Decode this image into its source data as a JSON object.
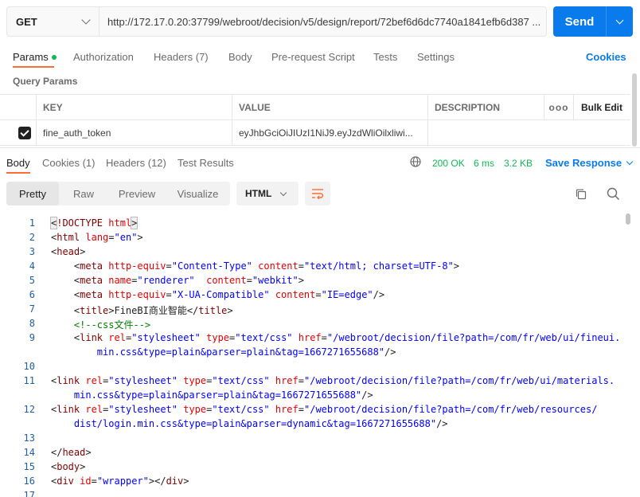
{
  "request": {
    "method": "GET",
    "url": "http://172.17.0.20:37799/webroot/decision/v5/design/report/72bef6d6dc7740a1841efb6d387 ...",
    "send_label": "Send"
  },
  "request_tabs": [
    {
      "label": "Params",
      "active": true
    },
    {
      "label": "Authorization"
    },
    {
      "label": "Headers (7)"
    },
    {
      "label": "Body"
    },
    {
      "label": "Pre-request Script"
    },
    {
      "label": "Tests"
    },
    {
      "label": "Settings"
    }
  ],
  "cookies_label": "Cookies",
  "query_params_title": "Query Params",
  "params_table": {
    "headers": [
      "KEY",
      "VALUE",
      "DESCRIPTION",
      "ooo",
      "Bulk Edit"
    ],
    "rows": [
      {
        "checked": true,
        "key": "fine_auth_token",
        "value": "eyJhbGciOiJIUzI1NiJ9.eyJzdWliOilxliwi...",
        "description": ""
      }
    ]
  },
  "response_tabs": [
    {
      "label": "Body",
      "active": true
    },
    {
      "label": "Cookies (1)"
    },
    {
      "label": "Headers (12)"
    },
    {
      "label": "Test Results"
    }
  ],
  "response_status": {
    "code": "200 OK",
    "time": "6 ms",
    "size": "3.2 KB"
  },
  "save_response_label": "Save Response",
  "view_modes": [
    {
      "label": "Pretty",
      "active": true
    },
    {
      "label": "Raw"
    },
    {
      "label": "Preview"
    },
    {
      "label": "Visualize"
    }
  ],
  "language": "HTML",
  "colors": {
    "accent": "#097bed",
    "tab_indicator": "#ff6c37",
    "success": "#0cbb52"
  },
  "code_lines": [
    {
      "n": "1",
      "html": "<span class=\"b hl\">&lt;</span><span class=\"t\">!DOCTYPE</span> <span class=\"a\">html</span><span class=\"b hl\">&gt;</span>"
    },
    {
      "n": "2",
      "html": "<span class=\"b\">&lt;</span><span class=\"t\">html</span> <span class=\"a\">lang</span>=<span class=\"s\">\"en\"</span>&gt;"
    },
    {
      "n": "3",
      "html": "&lt;<span class=\"t\">head</span>&gt;"
    },
    {
      "n": "4",
      "html": "    &lt;<span class=\"t\">meta</span> <span class=\"a\">http-equiv</span>=<span class=\"s\">\"Content-Type\"</span> <span class=\"a\">content</span>=<span class=\"s\">\"text/html; charset=UTF-8\"</span>&gt;"
    },
    {
      "n": "5",
      "html": "    &lt;<span class=\"t\">meta</span> <span class=\"a\">name</span>=<span class=\"s\">\"renderer\"</span>  <span class=\"a\">content</span>=<span class=\"s\">\"webkit\"</span>&gt;"
    },
    {
      "n": "6",
      "html": "    &lt;<span class=\"t\">meta</span> <span class=\"a\">http-equiv</span>=<span class=\"s\">\"X-UA-Compatible\"</span> <span class=\"a\">content</span>=<span class=\"s\">\"IE=edge\"</span>/&gt;"
    },
    {
      "n": "7",
      "html": "    &lt;<span class=\"t\">title</span>&gt;FineBI商业智能&lt;/<span class=\"t\">title</span>&gt;"
    },
    {
      "n": "8",
      "html": "    <span class=\"c\">&lt;!--css文件--&gt;</span>"
    },
    {
      "n": "9",
      "html": "    &lt;<span class=\"t\">link</span> <span class=\"a\">rel</span>=<span class=\"s\">\"stylesheet\"</span> <span class=\"a\">type</span>=<span class=\"s\">\"text/css\"</span> <span class=\"a\">href</span>=<span class=\"s\">\"/webroot/decision/file?path=/com/fr/web/ui/fineui.</span>"
    },
    {
      "n": "",
      "html": "        <span class=\"s\">min.css&amp;type=plain&amp;parser=plain&amp;tag=1667271655688\"</span>/&gt;"
    },
    {
      "n": "10",
      "html": ""
    },
    {
      "n": "11",
      "html": "&lt;<span class=\"t\">link</span> <span class=\"a\">rel</span>=<span class=\"s\">\"stylesheet\"</span> <span class=\"a\">type</span>=<span class=\"s\">\"text/css\"</span> <span class=\"a\">href</span>=<span class=\"s\">\"/webroot/decision/file?path=/com/fr/web/ui/materials.</span>"
    },
    {
      "n": "",
      "html": "    <span class=\"s\">min.css&amp;type=plain&amp;parser=plain&amp;tag=1667271655688\"</span>/&gt;"
    },
    {
      "n": "12",
      "html": "&lt;<span class=\"t\">link</span> <span class=\"a\">rel</span>=<span class=\"s\">\"stylesheet\"</span> <span class=\"a\">type</span>=<span class=\"s\">\"text/css\"</span> <span class=\"a\">href</span>=<span class=\"s\">\"/webroot/decision/file?path=/com/fr/web/resources/</span>"
    },
    {
      "n": "",
      "html": "    <span class=\"s\">dist/login.min.css&amp;type=plain&amp;parser=dynamic&amp;tag=1667271655688\"</span>/&gt;"
    },
    {
      "n": "13",
      "html": ""
    },
    {
      "n": "14",
      "html": "&lt;/<span class=\"t\">head</span>&gt;"
    },
    {
      "n": "15",
      "html": "&lt;<span class=\"t\">body</span>&gt;"
    },
    {
      "n": "16",
      "html": "&lt;<span class=\"t\">div</span> <span class=\"a\">id</span>=<span class=\"s\">\"wrapper\"</span>&gt;&lt;/<span class=\"t\">div</span>&gt;"
    },
    {
      "n": "17",
      "html": ""
    }
  ]
}
